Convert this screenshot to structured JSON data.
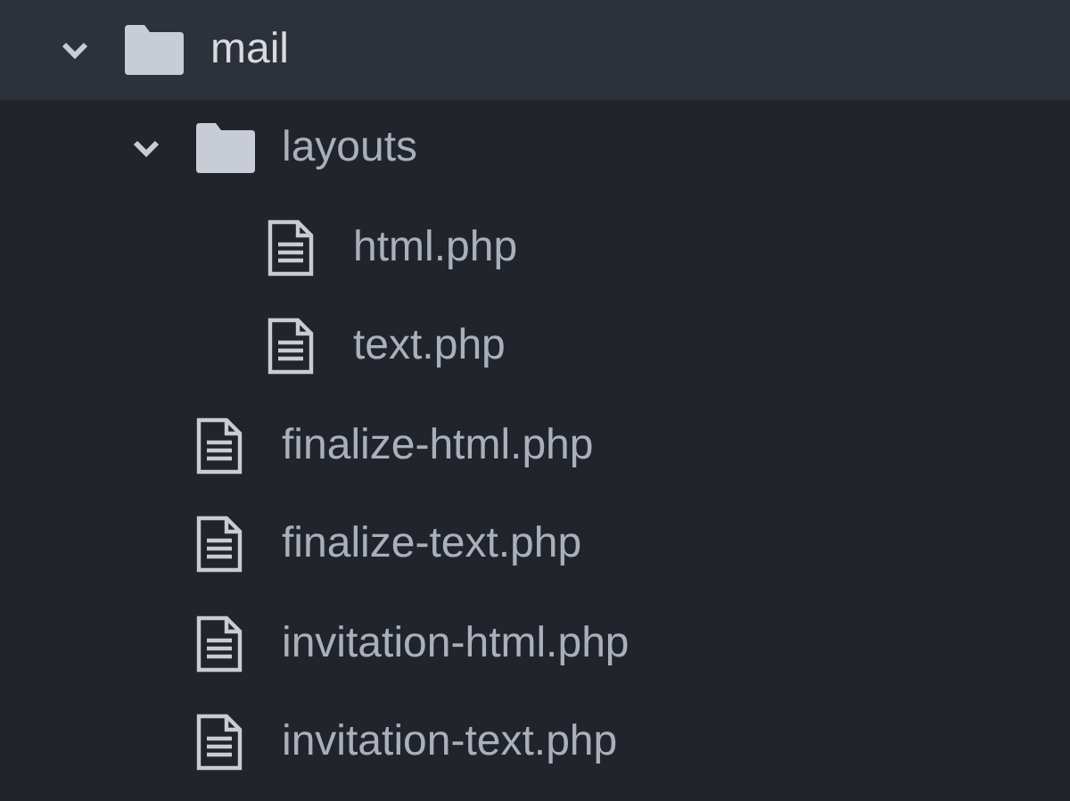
{
  "tree": [
    {
      "name": "mail",
      "kind": "folder",
      "expanded": true,
      "selected": true,
      "children": [
        {
          "name": "layouts",
          "kind": "folder",
          "expanded": true,
          "selected": false,
          "children": [
            {
              "name": "html.php",
              "kind": "file",
              "selected": false
            },
            {
              "name": "text.php",
              "kind": "file",
              "selected": false
            }
          ]
        },
        {
          "name": "finalize-html.php",
          "kind": "file",
          "selected": false
        },
        {
          "name": "finalize-text.php",
          "kind": "file",
          "selected": false
        },
        {
          "name": "invitation-html.php",
          "kind": "file",
          "selected": false
        },
        {
          "name": "invitation-text.php",
          "kind": "file",
          "selected": false
        }
      ]
    }
  ]
}
